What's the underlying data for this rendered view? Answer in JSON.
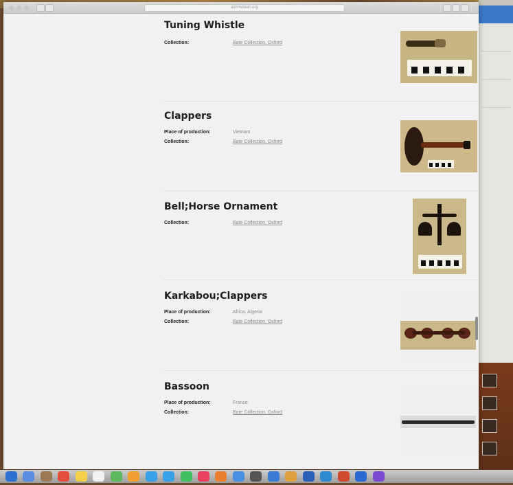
{
  "browser": {
    "address": "ashmolean.org"
  },
  "results": [
    {
      "title": "Tuning Whistle",
      "fields": [
        {
          "label": "Collection:",
          "value": "Bate Collection, Oxford",
          "link": true
        }
      ],
      "image": "tuning-whistle-photo"
    },
    {
      "title": "Clappers",
      "fields": [
        {
          "label": "Place of production:",
          "value": "Vietnam",
          "link": false
        },
        {
          "label": "Collection:",
          "value": "Bate Collection, Oxford",
          "link": true
        }
      ],
      "image": "clappers-photo"
    },
    {
      "title": "Bell;Horse Ornament",
      "fields": [
        {
          "label": "Collection:",
          "value": "Bate Collection, Oxford",
          "link": true
        }
      ],
      "image": "bell-horse-ornament-photo"
    },
    {
      "title": "Karkabou;Clappers",
      "fields": [
        {
          "label": "Place of production:",
          "value": "Africa, Algeria",
          "link": false
        },
        {
          "label": "Collection:",
          "value": "Bate Collection, Oxford",
          "link": true
        }
      ],
      "image": "karkabou-clappers-photo"
    },
    {
      "title": "Bassoon",
      "fields": [
        {
          "label": "Place of production:",
          "value": "France",
          "link": false
        },
        {
          "label": "Collection:",
          "value": "Bate Collection, Oxford",
          "link": true
        }
      ],
      "image": "bassoon-photo"
    }
  ],
  "colors": {
    "background": "#f1f1f1",
    "title": "#1e1e1e",
    "muted": "#8a8a8a",
    "photo_backdrop": "#c9b98a"
  }
}
